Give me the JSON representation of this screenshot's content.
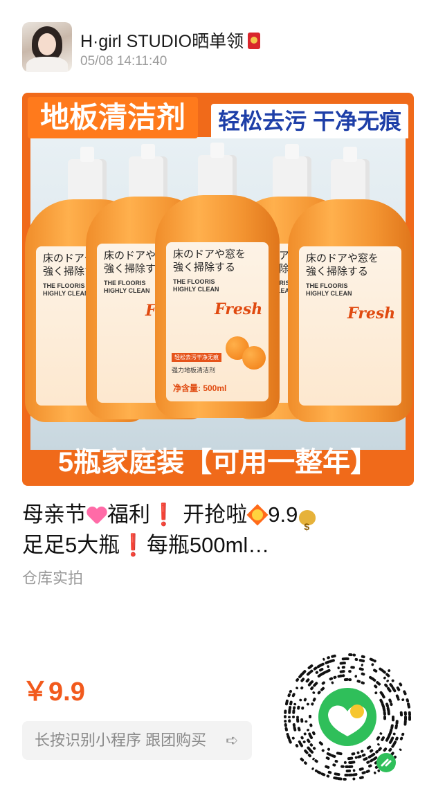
{
  "header": {
    "name": "H·girl STUDIO晒单领",
    "time": "05/08 14:11:40"
  },
  "product_image": {
    "title_left": "地板清洁剂",
    "title_right": "轻松去污 干净无痕",
    "bottom": "5瓶家庭装【可用一整年】",
    "bottle_label_jp": "床のドアや窓を\n強く掃除する",
    "bottle_label_en": "THE FLOORIS\nHIGHLY CLEAN",
    "bottle_fresh": "Fresh",
    "bottle_small1": "轻松去污干净无痕",
    "bottle_small2": "强力地板清洁剂",
    "bottle_volume": "净含量: 500ml",
    "colors": {
      "orange": "#f06a1a",
      "blue_text": "#1e3fa8"
    }
  },
  "description": {
    "line1_a": "母亲节",
    "line1_b": "福利",
    "line1_c": " 开抢啦",
    "line1_d": "9.9",
    "line2_a": "足足5大瓶",
    "line2_b": "每瓶500ml…",
    "excl": "❗"
  },
  "subtext": "仓库实拍",
  "price": "￥9.9",
  "cta": {
    "label": "长按识别小程序 跟团购买",
    "arrow": "➪"
  },
  "qr": {
    "logo_icon": "mini-program-logo-icon"
  }
}
